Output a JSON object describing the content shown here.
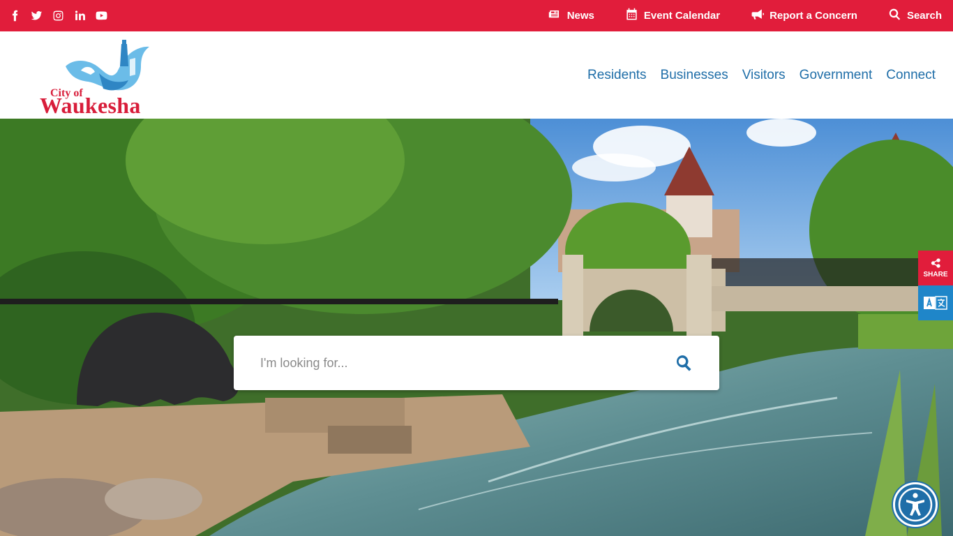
{
  "topbar": {
    "social": [
      {
        "name": "facebook-icon"
      },
      {
        "name": "twitter-icon"
      },
      {
        "name": "instagram-icon"
      },
      {
        "name": "linkedin-icon"
      },
      {
        "name": "youtube-icon"
      }
    ],
    "links": [
      {
        "label": "News",
        "icon": "newspaper-icon"
      },
      {
        "label": "Event Calendar",
        "icon": "calendar-icon"
      },
      {
        "label": "Report a Concern",
        "icon": "megaphone-icon"
      },
      {
        "label": "Search",
        "icon": "search-icon"
      }
    ]
  },
  "logo": {
    "small": "City of",
    "big": "Waukesha"
  },
  "nav": {
    "items": [
      "Residents",
      "Businesses",
      "Visitors",
      "Government",
      "Connect"
    ]
  },
  "hero": {
    "search_placeholder": "I'm looking for..."
  },
  "sidebar": {
    "share_label": "SHARE"
  },
  "colors": {
    "brand_red": "#e11d3b",
    "nav_blue": "#1f6ea8",
    "translate_blue": "#1f86c9"
  }
}
